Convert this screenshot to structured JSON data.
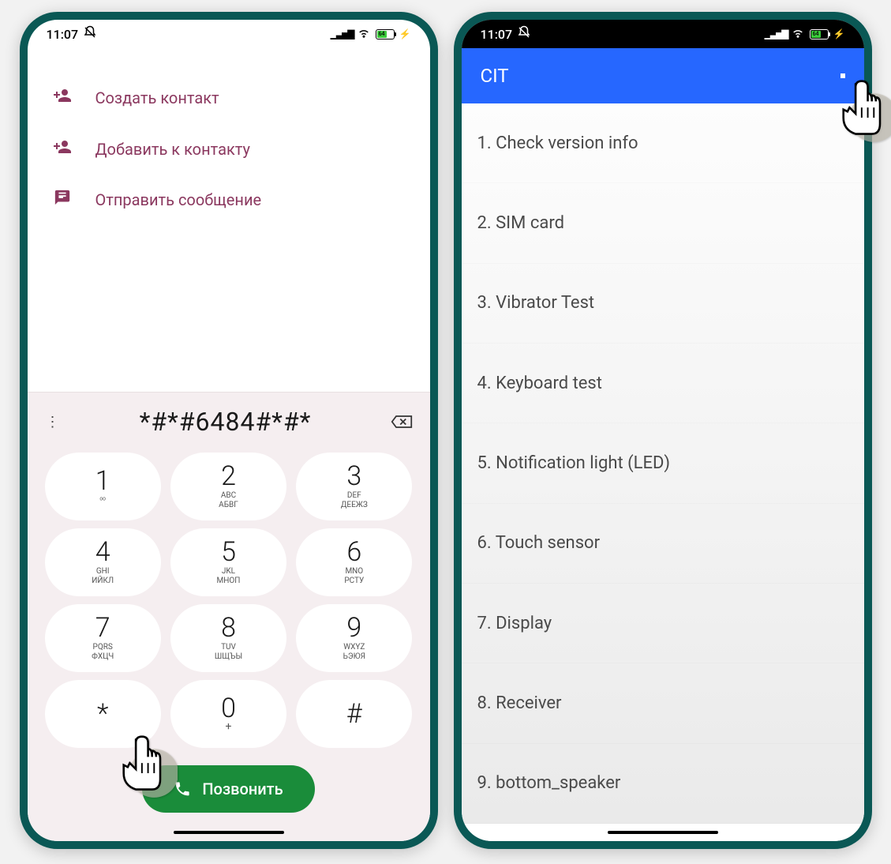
{
  "status": {
    "time": "11:07",
    "batteryPct": "64"
  },
  "dialer": {
    "actions": {
      "create": "Создать контакт",
      "add": "Добавить к контакту",
      "message": "Отправить сообщение"
    },
    "entered": "*#*#6484#*#*",
    "keys": [
      {
        "d": "1",
        "sub1": "ᵒᵒ",
        "sub2": ""
      },
      {
        "d": "2",
        "sub1": "ABC",
        "sub2": "АБВГ"
      },
      {
        "d": "3",
        "sub1": "DEF",
        "sub2": "ДЕЕЖЗ"
      },
      {
        "d": "4",
        "sub1": "GHI",
        "sub2": "ИЙКЛ"
      },
      {
        "d": "5",
        "sub1": "JKL",
        "sub2": "МНОП"
      },
      {
        "d": "6",
        "sub1": "MNO",
        "sub2": "РСТУ"
      },
      {
        "d": "7",
        "sub1": "PQRS",
        "sub2": "ФХЦЧ"
      },
      {
        "d": "8",
        "sub1": "TUV",
        "sub2": "ШЩЪЫ"
      },
      {
        "d": "9",
        "sub1": "WXYZ",
        "sub2": "ЬЭЮЯ"
      },
      {
        "d": "*",
        "sub1": "",
        "sub2": ""
      },
      {
        "d": "0",
        "sub1": "+",
        "sub2": ""
      },
      {
        "d": "#",
        "sub1": "",
        "sub2": ""
      }
    ],
    "call_label": "Позвонить"
  },
  "cit": {
    "title": "CIT",
    "items": [
      "1. Check version info",
      "2. SIM card",
      "3. Vibrator Test",
      "4. Keyboard test",
      "5. Notification light (LED)",
      "6. Touch sensor",
      "7. Display",
      "8. Receiver",
      "9. bottom_speaker"
    ]
  }
}
